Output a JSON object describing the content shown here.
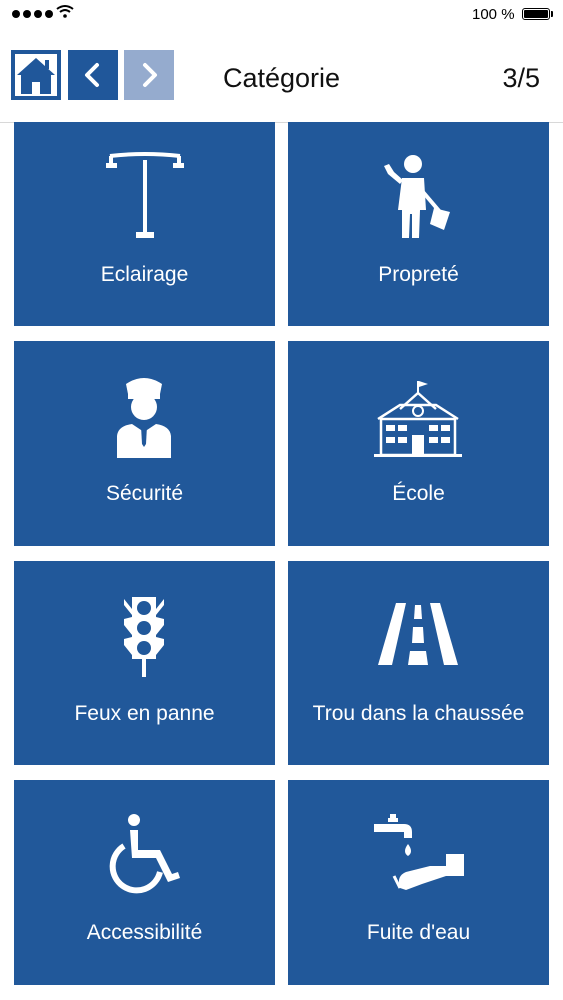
{
  "status_bar": {
    "battery_label": "100 %"
  },
  "header": {
    "title": "Catégorie",
    "counter": "3/5",
    "home_icon": "home-icon",
    "back_icon": "chevron-left-icon",
    "forward_icon": "chevron-right-icon"
  },
  "colors": {
    "tile_bg": "#21589a",
    "nav_active": "#20579a",
    "nav_disabled": "#95abce"
  },
  "categories": [
    {
      "label": "Eclairage",
      "icon": "streetlight-icon"
    },
    {
      "label": "Propreté",
      "icon": "street-sweeper-icon"
    },
    {
      "label": "Sécurité",
      "icon": "police-officer-icon"
    },
    {
      "label": "École",
      "icon": "school-building-icon"
    },
    {
      "label": "Feux en panne",
      "icon": "traffic-light-icon"
    },
    {
      "label": "Trou dans la chaussée",
      "icon": "road-icon"
    },
    {
      "label": "Accessibilité",
      "icon": "wheelchair-icon"
    },
    {
      "label": "Fuite d'eau",
      "icon": "water-leak-icon"
    }
  ]
}
